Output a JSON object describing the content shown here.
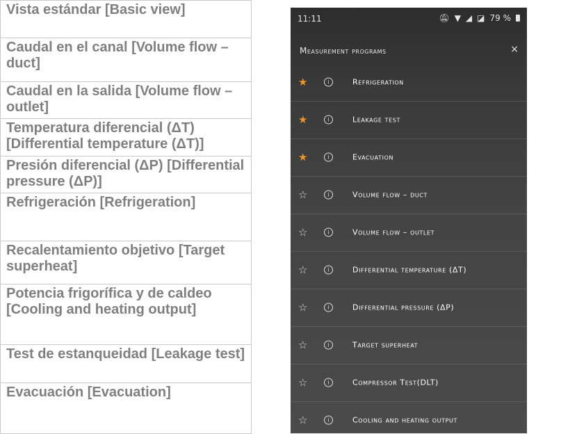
{
  "table": {
    "rows": [
      {
        "text": "Vista estándar [Basic view]"
      },
      {
        "text": "Caudal en el canal [Volume flow – duct]"
      },
      {
        "text": "Caudal en la salida [Volume flow – outlet]"
      },
      {
        "text": "Temperatura diferencial (ΔT) [Differential temperature (ΔT)]"
      },
      {
        "text": "Presión diferencial (ΔP) [Differential pressure (ΔP)]"
      },
      {
        "text": "Refrigeración [Refrigeration]"
      },
      {
        "text": "Recalentamiento objetivo [Target superheat]"
      },
      {
        "text": "Potencia frigorífica y de caldeo [Cooling and heating output]"
      },
      {
        "text": "Test de estanqueidad [Leakage test]"
      },
      {
        "text": "Evacuación [Evacuation]"
      }
    ]
  },
  "phone": {
    "status": {
      "time": "11:11",
      "battery": "79 %"
    },
    "header": {
      "title": "Measurement programs",
      "close_icon": "×"
    },
    "programs": [
      {
        "label": "Refrigeration",
        "favorite": true
      },
      {
        "label": "Leakage test",
        "favorite": true
      },
      {
        "label": "Evacuation",
        "favorite": true
      },
      {
        "label": "Volume flow – duct",
        "favorite": false
      },
      {
        "label": "Volume flow – outlet",
        "favorite": false
      },
      {
        "label": "Differential temperature (ΔT)",
        "favorite": false
      },
      {
        "label": "Differential pressure (ΔP)",
        "favorite": false
      },
      {
        "label": "Target superheat",
        "favorite": false
      },
      {
        "label": "Compressor Test(DLT)",
        "favorite": false
      },
      {
        "label": "Cooling and heating output",
        "favorite": false
      }
    ],
    "colors": {
      "favorite_star": "#f0932b",
      "background": "#3b3b3b"
    }
  }
}
